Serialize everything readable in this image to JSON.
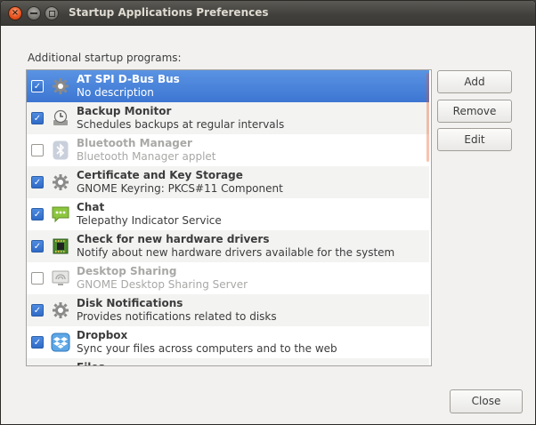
{
  "window": {
    "title": "Startup Applications Preferences",
    "close_glyph": "×",
    "section_label": "Additional startup programs:"
  },
  "items": [
    {
      "name": "AT SPI D-Bus Bus",
      "description": "No description",
      "checked": true,
      "enabled": true,
      "selected": true,
      "icon": "gear-icon"
    },
    {
      "name": "Backup Monitor",
      "description": "Schedules backups at regular intervals",
      "checked": true,
      "enabled": true,
      "selected": false,
      "icon": "backup-icon"
    },
    {
      "name": "Bluetooth Manager",
      "description": "Bluetooth Manager applet",
      "checked": false,
      "enabled": false,
      "selected": false,
      "icon": "bluetooth-icon"
    },
    {
      "name": "Certificate and Key Storage",
      "description": "GNOME Keyring: PKCS#11 Component",
      "checked": true,
      "enabled": true,
      "selected": false,
      "icon": "gear-icon"
    },
    {
      "name": "Chat",
      "description": "Telepathy Indicator Service",
      "checked": true,
      "enabled": true,
      "selected": false,
      "icon": "chat-icon"
    },
    {
      "name": "Check for new hardware drivers",
      "description": "Notify about new hardware drivers available for the system",
      "checked": true,
      "enabled": true,
      "selected": false,
      "icon": "hardware-chip-icon"
    },
    {
      "name": "Desktop Sharing",
      "description": "GNOME Desktop Sharing Server",
      "checked": false,
      "enabled": false,
      "selected": false,
      "icon": "desktop-sharing-icon"
    },
    {
      "name": "Disk Notifications",
      "description": "Provides notifications related to disks",
      "checked": true,
      "enabled": true,
      "selected": false,
      "icon": "gear-icon"
    },
    {
      "name": "Dropbox",
      "description": "Sync your files across computers and to the web",
      "checked": true,
      "enabled": true,
      "selected": false,
      "icon": "dropbox-icon"
    },
    {
      "name": "Files",
      "description": "",
      "checked": true,
      "enabled": true,
      "selected": false,
      "icon": "gear-icon"
    }
  ],
  "buttons": {
    "add": "Add",
    "remove": "Remove",
    "edit": "Edit",
    "close": "Close"
  },
  "colors": {
    "selection": "#3c76d2",
    "accent": "#e95420"
  }
}
